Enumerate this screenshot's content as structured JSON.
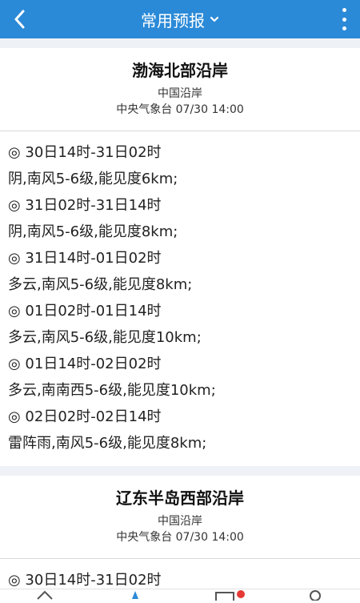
{
  "header": {
    "title": "常用预报",
    "back_icon": "chevron-left-icon",
    "dropdown_icon": "chevron-down-icon",
    "menu_icon": "more-vertical-icon",
    "bg": "#2b8ad8"
  },
  "cards": [
    {
      "title": "渤海北部沿岸",
      "region": "中国沿岸",
      "source": "中央气象台 07/30 14:00",
      "lines": [
        "◎ 30日14时-31日02时",
        "阴,南风5-6级,能见度6km;",
        "◎ 31日02时-31日14时",
        "阴,南风5-6级,能见度8km;",
        "◎ 31日14时-01日02时",
        "多云,南风5-6级,能见度8km;",
        "◎ 01日02时-01日14时",
        "多云,南风5-6级,能见度10km;",
        "◎ 01日14时-02日02时",
        "多云,南南西5-6级,能见度10km;",
        "◎ 02日02时-02日14时",
        "雷阵雨,南风5-6级,能见度8km;"
      ]
    },
    {
      "title": "辽东半岛西部沿岸",
      "region": "中国沿岸",
      "source": "中央气象台 07/30 14:00",
      "lines": [
        "◎ 30日14时-31日02时"
      ]
    }
  ],
  "tabbar": {
    "icons": [
      "home-icon",
      "location-icon",
      "message-icon",
      "user-icon"
    ],
    "badge_color": "#e53935"
  }
}
